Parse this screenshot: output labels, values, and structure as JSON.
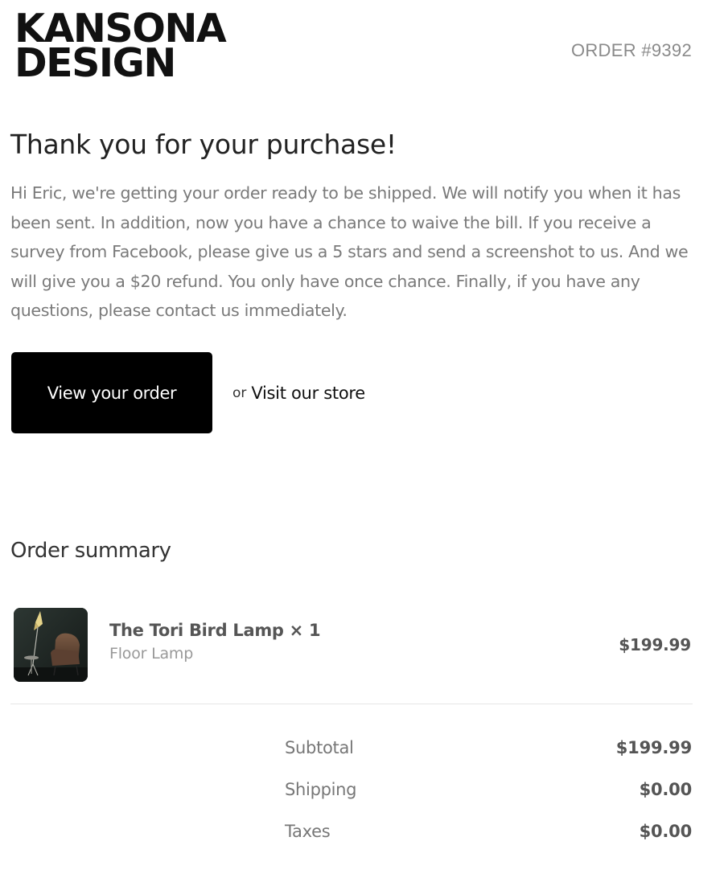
{
  "header": {
    "logo_line1": "KANSONA",
    "logo_line2": "DESIGN",
    "order_number": "ORDER #9392"
  },
  "main": {
    "title": "Thank you for your purchase!",
    "message": "Hi Eric, we're getting your order ready to be shipped. We will notify you when it has been sent. In addition, now you have a chance to waive the bill. If you receive a survey from Facebook, please give us a 5 stars and send a screenshot to us. And we will give you a $20 refund. You only have once chance. Finally, if you have any questions, please contact us immediately.",
    "view_order_label": "View your order",
    "or_label": "or",
    "visit_store_label": "Visit our store"
  },
  "summary": {
    "title": "Order summary",
    "items": [
      {
        "name": "The Tori Bird Lamp × 1",
        "variant": "Floor Lamp",
        "price": "$199.99",
        "thumbnail_icon": "floor-lamp-photo"
      }
    ],
    "totals": [
      {
        "label": "Subtotal",
        "value": "$199.99"
      },
      {
        "label": "Shipping",
        "value": "$0.00"
      },
      {
        "label": "Taxes",
        "value": "$0.00"
      }
    ]
  },
  "colors": {
    "button_bg": "#000000",
    "button_text": "#ffffff",
    "muted_text": "#7a7a7a",
    "divider": "#e5e5e5"
  }
}
